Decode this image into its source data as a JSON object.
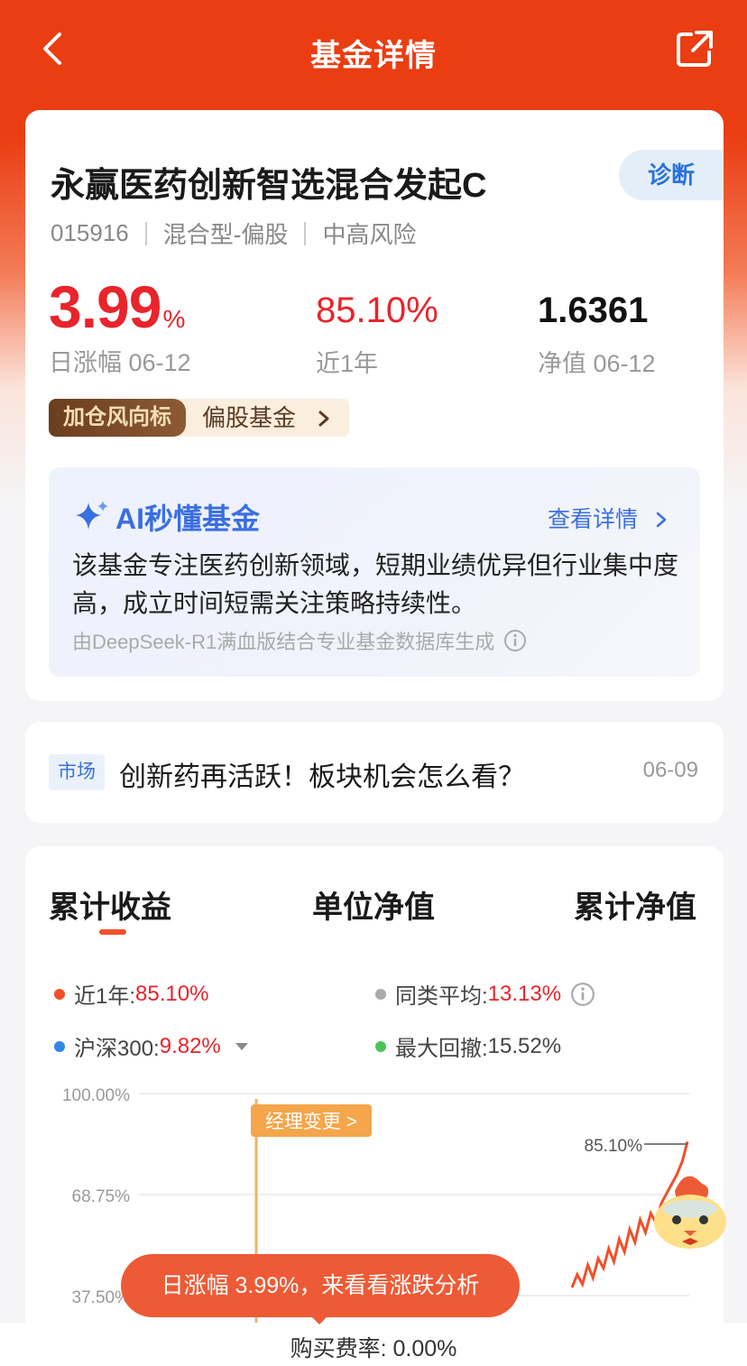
{
  "header": {
    "title": "基金详情"
  },
  "fund": {
    "name": "永赢医药创新智选混合发起C",
    "diagnose": "诊断",
    "code": "015916",
    "type": "混合型-偏股",
    "risk": "中高风险",
    "daily_change_value": "3.99",
    "daily_change_unit": "%",
    "daily_change_label": "日涨幅 06-12",
    "year_return": "85.10%",
    "year_return_label": "近1年",
    "nav": "1.6361",
    "nav_label": "净值 06-12",
    "tag_badge": "加仓风向标",
    "tag_text": "偏股基金"
  },
  "ai": {
    "title": "AI秒懂基金",
    "more": "查看详情",
    "summary": "该基金专注医药创新领域，短期业绩优异但行业集中度高，成立时间短需关注策略持续性。",
    "source": "由DeepSeek-R1满血版结合专业基金数据库生成"
  },
  "news": {
    "tag": "市场",
    "title": "创新药再活跃！板块机会怎么看？",
    "date": "06-09"
  },
  "chart_tabs": [
    "累计收益",
    "单位净值",
    "累计净值"
  ],
  "legend": {
    "fund_label": "近1年:",
    "fund_value": "85.10%",
    "peer_label": "同类平均:",
    "peer_value": "13.13%",
    "index_label": "沪深300:",
    "index_value": "9.82%",
    "drawdown_label": "最大回撤:",
    "drawdown_value": "15.52%"
  },
  "chart_data": {
    "type": "line",
    "y_tick_labels": [
      "100.00%",
      "68.75%",
      "37.50%"
    ],
    "ylim": [
      37.5,
      100
    ],
    "annotation_manager": "经理变更 >",
    "end_label": "85.10%",
    "series": [
      {
        "name": "近1年",
        "values": [
          40,
          44,
          41,
          47,
          43,
          49,
          46,
          52,
          48,
          55,
          51,
          58,
          54,
          61,
          57,
          63,
          60,
          66,
          69,
          72,
          75,
          79,
          85.1
        ]
      }
    ]
  },
  "toast": "日涨幅 3.99%，来看看涨跌分析",
  "footer": {
    "fee": "购买费率: 0.00%"
  },
  "colors": {
    "brand": "#ea3d12",
    "up": "#e8242c",
    "ai": "#3a6fe0"
  }
}
